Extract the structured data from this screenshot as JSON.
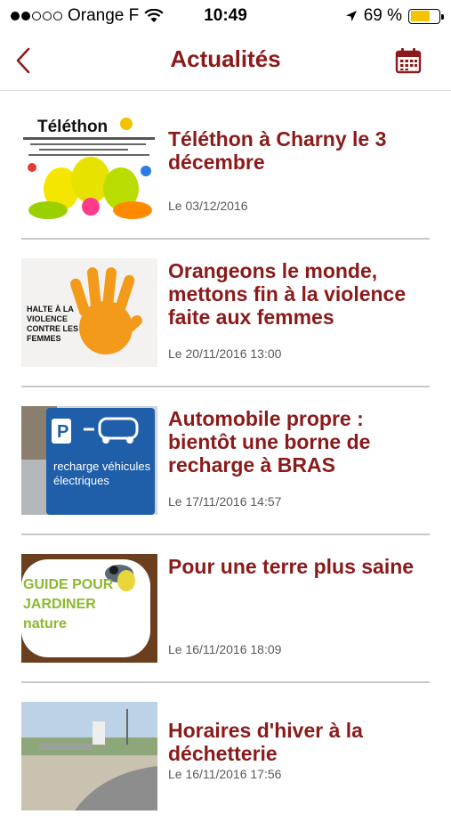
{
  "status_bar": {
    "carrier": "Orange F",
    "time": "10:49",
    "battery_text": "69 %",
    "battery_level": 0.69,
    "battery_color": "#f5c400"
  },
  "nav": {
    "title": "Actualités",
    "back_icon": "chevron-left-icon",
    "calendar_icon": "calendar-icon",
    "accent_color": "#8b1a1a"
  },
  "news": [
    {
      "title": "Téléthon à Charny le 3 décembre",
      "date": "Le 03/12/2016",
      "thumb_text": "Téléthon"
    },
    {
      "title": "Orangeons le monde, mettons fin à la violence faite aux femmes",
      "date": "Le 20/11/2016 13:00",
      "thumb_text": "HALTE À LA VIOLENCE CONTRE LES FEMMES"
    },
    {
      "title": "Automobile propre : bientôt une borne de recharge à BRAS",
      "date": "Le 17/11/2016 14:57",
      "thumb_text": "recharge véhicules électriques"
    },
    {
      "title": "Pour une terre plus saine",
      "date": "Le 16/11/2016 18:09",
      "thumb_text": "GUIDE POUR JARDINER nature"
    },
    {
      "title": "Horaires d'hiver à la déchetterie",
      "date": "Le 16/11/2016 17:56",
      "thumb_text": ""
    }
  ]
}
